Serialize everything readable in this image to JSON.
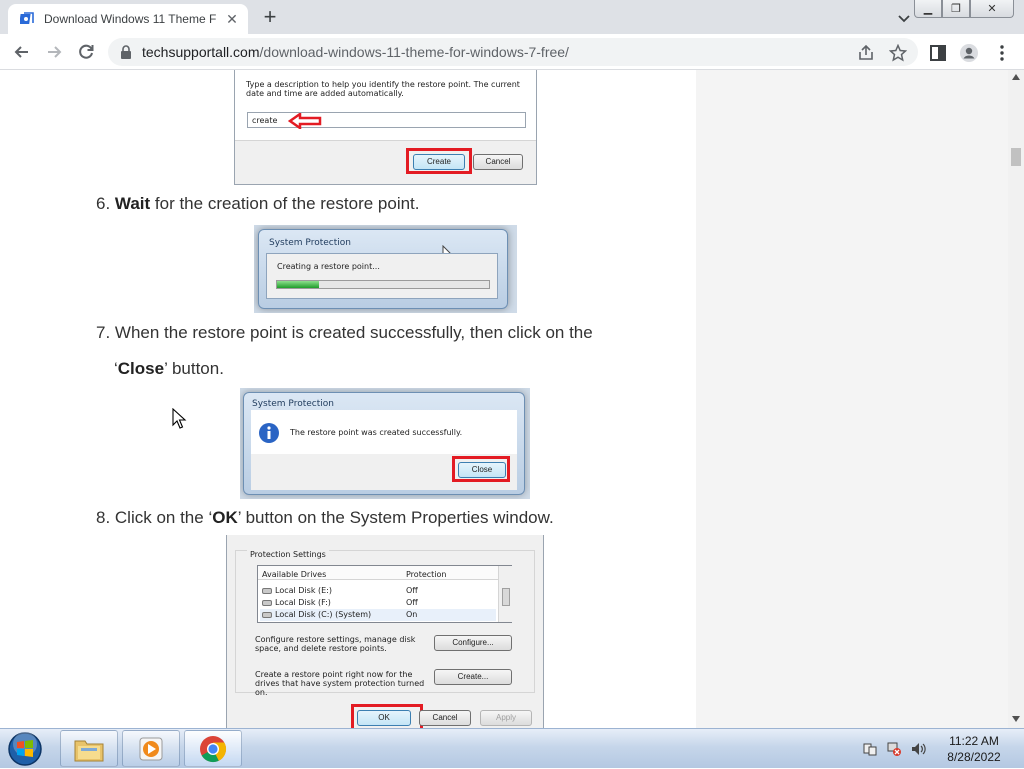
{
  "browser": {
    "tab": {
      "title": "Download Windows 11 Theme F",
      "favicon": "site-favicon",
      "close_label": "✕"
    },
    "new_tab_label": "+",
    "address": {
      "domain": "techsupportall.com",
      "path": "/download-windows-11-theme-for-windows-7-free/"
    },
    "window_buttons": {
      "minimize": "▁",
      "maximize": "❐",
      "close": "✕"
    }
  },
  "article": {
    "step6": {
      "num": "6. ",
      "bold": "Wait",
      "rest": " for the creation of the restore point."
    },
    "step7": {
      "line1": "7. When the restore point is created successfully, then click on the",
      "pre": "‘",
      "bold": "Close",
      "rest": "’ button."
    },
    "step8": {
      "pre": "8. Click on the ‘",
      "bold": "OK",
      "rest": "’ button on the System Properties window."
    }
  },
  "img_create": {
    "description": "Type a description to help you identify the restore point. The current date and time are added automatically.",
    "input_value": "create",
    "create_label": "Create",
    "cancel_label": "Cancel"
  },
  "img_progress": {
    "title": "System Protection",
    "message": "Creating a restore point...",
    "progress_fraction": 0.2
  },
  "img_success": {
    "title": "System Protection",
    "message": "The restore point was created successfully.",
    "close_label": "Close"
  },
  "img_props": {
    "group": "Protection Settings",
    "col_drives": "Available Drives",
    "col_protection": "Protection",
    "drives": [
      {
        "name": "Local Disk (E:)",
        "protection": "Off"
      },
      {
        "name": "Local Disk (F:)",
        "protection": "Off"
      },
      {
        "name": "Local Disk (C:) (System)",
        "protection": "On"
      }
    ],
    "configure_text": "Configure restore settings, manage disk space, and delete restore points.",
    "configure_label": "Configure...",
    "create_text": "Create a restore point right now for the drives that have system protection turned on.",
    "create_label": "Create...",
    "ok_label": "OK",
    "cancel_label": "Cancel",
    "apply_label": "Apply"
  },
  "taskbar": {
    "apps": [
      "windows-explorer",
      "media-player",
      "chrome"
    ],
    "time": "11:22 AM",
    "date": "8/28/2022"
  },
  "colors": {
    "highlight_red": "#e31b23",
    "sidebar_bg": "#f4f4f4"
  }
}
